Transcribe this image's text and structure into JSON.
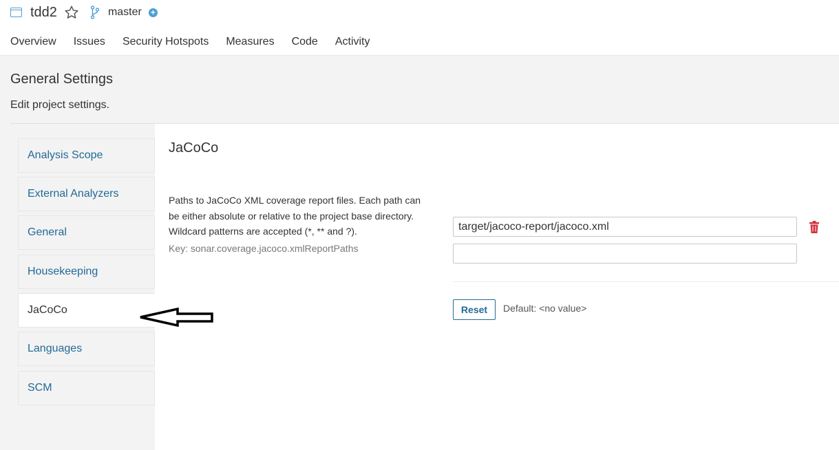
{
  "header": {
    "project_name": "tdd2",
    "project_icon": "project-icon",
    "star_icon": "star-icon",
    "branch_icon": "branch-icon",
    "branch_name": "master",
    "add_icon": "plus-circle-icon"
  },
  "nav": {
    "items": [
      {
        "label": "Overview"
      },
      {
        "label": "Issues"
      },
      {
        "label": "Security Hotspots"
      },
      {
        "label": "Measures"
      },
      {
        "label": "Code"
      },
      {
        "label": "Activity"
      }
    ]
  },
  "page": {
    "title": "General Settings",
    "description": "Edit project settings."
  },
  "sidebar": {
    "items": [
      {
        "label": "Analysis Scope",
        "active": false
      },
      {
        "label": "External Analyzers",
        "active": false
      },
      {
        "label": "General",
        "active": false
      },
      {
        "label": "Housekeeping",
        "active": false
      },
      {
        "label": "JaCoCo",
        "active": true
      },
      {
        "label": "Languages",
        "active": false
      },
      {
        "label": "SCM",
        "active": false
      }
    ]
  },
  "main": {
    "section_title": "JaCoCo",
    "setting": {
      "description": "Paths to JaCoCo XML coverage report files. Each path can be either absolute or relative to the project base directory. Wildcard patterns are accepted (*, ** and ?).",
      "key": "Key: sonar.coverage.jacoco.xmlReportPaths",
      "values": [
        "target/jacoco-report/jacoco.xml",
        ""
      ],
      "reset_label": "Reset",
      "default_text": "Default: <no value>"
    }
  },
  "colors": {
    "link": "#236a97",
    "accent": "#4b9fd5",
    "danger": "#d4333f",
    "background": "#f3f3f3"
  }
}
